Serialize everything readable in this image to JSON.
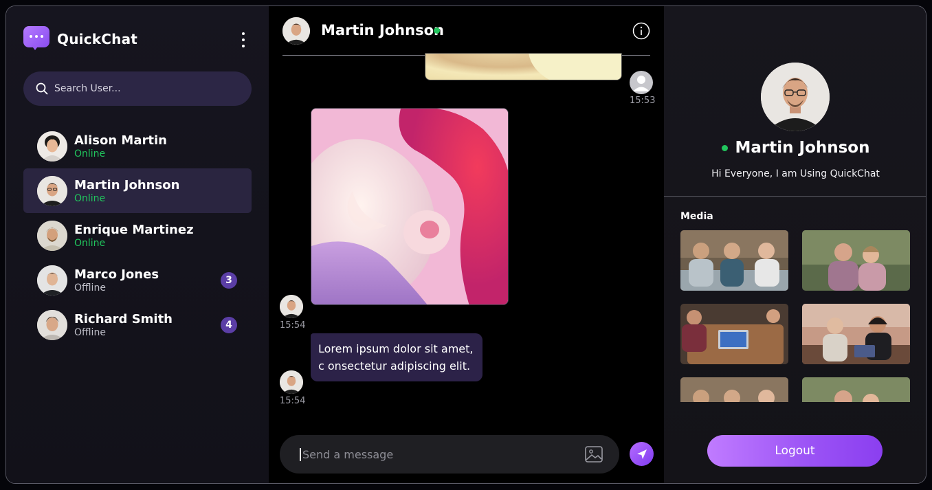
{
  "app": {
    "name": "QuickChat"
  },
  "search": {
    "placeholder": "Search User..."
  },
  "contacts": [
    {
      "name": "Alison Martin",
      "status": "Online",
      "unread": ""
    },
    {
      "name": "Martin Johnson",
      "status": "Online",
      "unread": "",
      "active": true
    },
    {
      "name": "Enrique Martinez",
      "status": "Online",
      "unread": ""
    },
    {
      "name": "Marco Jones",
      "status": "Offline",
      "unread": "3"
    },
    {
      "name": "Richard Smith",
      "status": "Offline",
      "unread": "4"
    }
  ],
  "chat": {
    "title": "Martin Johnson",
    "messages": [
      {
        "type": "image",
        "time": "15:53",
        "from": "me"
      },
      {
        "type": "image",
        "time": "15:54",
        "from": "them"
      },
      {
        "type": "text",
        "text": "Lorem ipsum dolor sit amet, c onsectetur adipiscing elit.",
        "time": "15:54",
        "from": "them"
      }
    ],
    "composer_placeholder": "Send a message"
  },
  "profile": {
    "name": "Martin Johnson",
    "bio": "Hi Everyone, I am Using QuickChat",
    "media_title": "Media",
    "logout_label": "Logout"
  },
  "colors": {
    "accent": "#8a4df0",
    "online": "#21c55d",
    "active_row": "#2a2540",
    "message_bubble": "#2c2248"
  },
  "icons": [
    "chat-logo-icon",
    "more-vertical-icon",
    "search-icon",
    "info-icon",
    "image-icon",
    "send-icon",
    "default-user-icon"
  ]
}
